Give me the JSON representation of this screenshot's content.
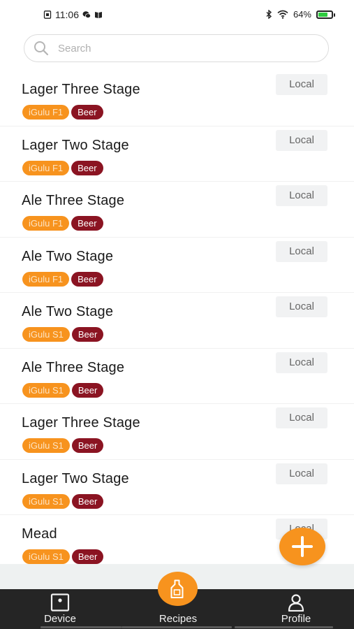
{
  "status_bar": {
    "time": "11:06",
    "battery_percent": "64%",
    "battery_level": 0.64,
    "icons": [
      "screenshot-icon",
      "wechat-icon",
      "book-icon",
      "bluetooth-icon",
      "wifi-icon",
      "battery-icon"
    ]
  },
  "search": {
    "placeholder": "Search",
    "value": ""
  },
  "recipes": [
    {
      "name": "Lager Three Stage",
      "device": "iGulu F1",
      "type": "Beer",
      "source": "Local"
    },
    {
      "name": "Lager Two Stage",
      "device": "iGulu F1",
      "type": "Beer",
      "source": "Local"
    },
    {
      "name": "Ale Three Stage",
      "device": "iGulu F1",
      "type": "Beer",
      "source": "Local"
    },
    {
      "name": "Ale Two Stage",
      "device": "iGulu F1",
      "type": "Beer",
      "source": "Local"
    },
    {
      "name": "Ale Two Stage",
      "device": "iGulu S1",
      "type": "Beer",
      "source": "Local"
    },
    {
      "name": "Ale Three Stage",
      "device": "iGulu S1",
      "type": "Beer",
      "source": "Local"
    },
    {
      "name": "Lager Three Stage",
      "device": "iGulu S1",
      "type": "Beer",
      "source": "Local"
    },
    {
      "name": "Lager Two Stage",
      "device": "iGulu S1",
      "type": "Beer",
      "source": "Local"
    },
    {
      "name": "Mead",
      "device": "iGulu S1",
      "type": "Beer",
      "source": "Local"
    }
  ],
  "fab": {
    "icon": "plus-icon"
  },
  "bottom_nav": {
    "items": [
      {
        "label": "Device",
        "icon": "device-icon"
      },
      {
        "label": "Recipes",
        "icon": "bottle-icon"
      },
      {
        "label": "Profile",
        "icon": "person-icon"
      }
    ],
    "active": "Recipes"
  },
  "colors": {
    "accent": "#f7931e",
    "tag_type": "#8b1422",
    "nav_background": "#252525",
    "badge_background": "#f1f2f3"
  }
}
